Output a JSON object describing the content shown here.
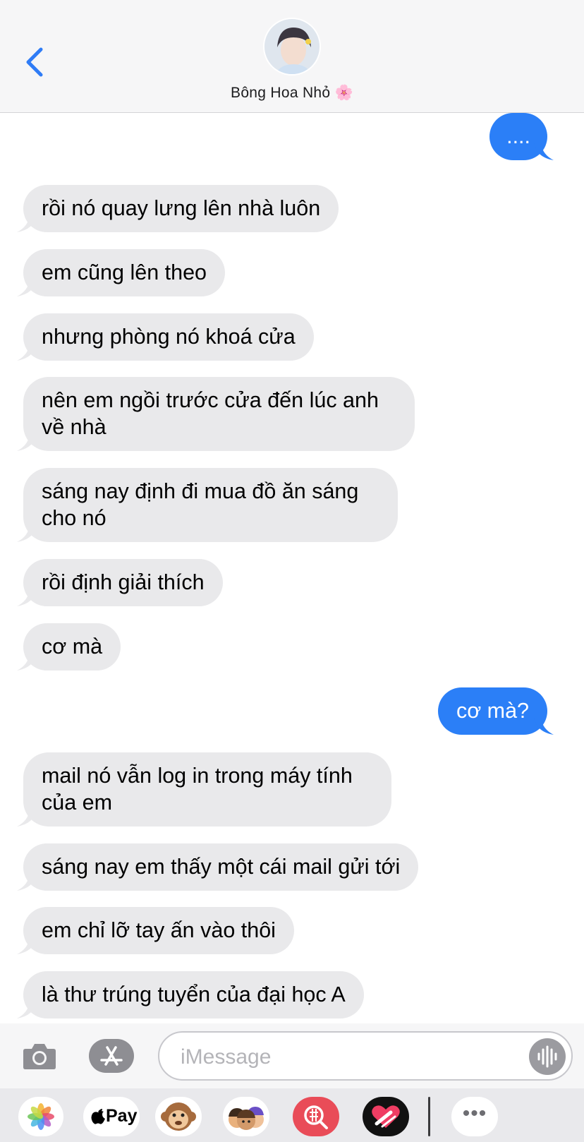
{
  "header": {
    "contact_name": "Bông Hoa Nhỏ 🌸"
  },
  "messages": [
    {
      "direction": "out",
      "lines": [
        "...."
      ]
    },
    {
      "direction": "in",
      "lines": [
        "rồi nó quay lưng lên nhà luôn"
      ]
    },
    {
      "direction": "in",
      "lines": [
        "em cũng lên theo"
      ]
    },
    {
      "direction": "in",
      "lines": [
        "nhưng phòng nó khoá cửa"
      ]
    },
    {
      "direction": "in",
      "lines": [
        "nên em ngồi trước cửa đến lúc anh",
        "về nhà"
      ]
    },
    {
      "direction": "in",
      "lines": [
        "sáng nay định đi mua đồ ăn sáng",
        "cho nó"
      ]
    },
    {
      "direction": "in",
      "lines": [
        "rồi định giải thích"
      ]
    },
    {
      "direction": "in",
      "lines": [
        "cơ mà"
      ]
    },
    {
      "direction": "out",
      "lines": [
        "cơ mà?"
      ]
    },
    {
      "direction": "in",
      "lines": [
        "mail nó vẫn log in trong máy tính",
        "của em"
      ]
    },
    {
      "direction": "in",
      "lines": [
        "sáng nay em thấy một cái mail gửi tới"
      ]
    },
    {
      "direction": "in",
      "lines": [
        "em chỉ lỡ tay ấn vào thôi"
      ]
    },
    {
      "direction": "in",
      "lines": [
        "là thư trúng tuyển của đại học A"
      ]
    }
  ],
  "input": {
    "placeholder": "iMessage"
  },
  "app_drawer": {
    "apps": [
      "photos-icon",
      "apple-pay-icon",
      "animoji-icon",
      "memoji-icon",
      "image-search-icon",
      "fitness-icon",
      "more-icon"
    ],
    "pay_label": "Pay",
    "more_label": "•••"
  },
  "colors": {
    "outgoing_bubble": "#2b7ff7",
    "incoming_bubble": "#e9e9eb",
    "header_bg": "#f6f6f7",
    "back_chevron": "#2f7cf6"
  }
}
